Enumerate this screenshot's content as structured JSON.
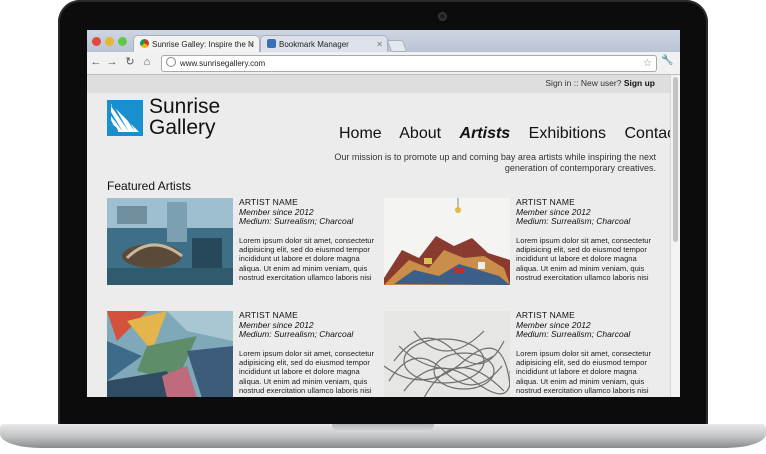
{
  "browser": {
    "tabs": [
      {
        "label": "Sunrise Galley: Inspire the N",
        "active": true
      },
      {
        "label": "Bookmark Manager",
        "active": false
      }
    ],
    "url": "www.sunrisegallery.com"
  },
  "site": {
    "signin": {
      "sign_in": "Sign in",
      "separator": " :: New user? ",
      "sign_up": "Sign up"
    },
    "logo": {
      "line1": "Sunrise",
      "line2": "Gallery"
    },
    "nav": [
      "Home",
      "About",
      "Artists",
      "Exhibitions",
      "Contact"
    ],
    "nav_active": "Artists",
    "mission": "Our mission is to promote up and coming bay area artists while inspiring the next generation of contemporary creatives.",
    "section_title": "Featured Artists",
    "artists": [
      {
        "name": "ARTIST NAME",
        "member": "Member since 2012",
        "medium": "Medium: Surrealism; Charcoal",
        "bio": "Lorem ipsum dolor sit amet, consectetur adipisicing elit, sed do eiusmod tempor incididunt ut labore et dolore magna aliqua. Ut enim ad minim veniam, quis nostrud exercitation ullamco laboris nisi"
      },
      {
        "name": "ARTIST NAME",
        "member": "Member since 2012",
        "medium": "Medium: Surrealism; Charcoal",
        "bio": "Lorem ipsum dolor sit amet, consectetur adipisicing elit, sed do eiusmod tempor incididunt ut labore et dolore magna aliqua. Ut enim ad minim veniam, quis nostrud exercitation ullamco laboris nisi"
      },
      {
        "name": "ARTIST NAME",
        "member": "Member since 2012",
        "medium": "Medium: Surrealism; Charcoal",
        "bio": "Lorem ipsum dolor sit amet, consectetur adipisicing elit, sed do eiusmod tempor incididunt ut labore et dolore magna aliqua. Ut enim ad minim veniam, quis nostrud exercitation ullamco laboris nisi"
      },
      {
        "name": "ARTIST NAME",
        "member": "Member since 2012",
        "medium": "Medium: Surrealism; Charcoal",
        "bio": "Lorem ipsum dolor sit amet, consectetur adipisicing elit, sed do eiusmod tempor incididunt ut labore et dolore magna aliqua. Ut enim ad minim veniam, quis nostrud exercitation ullamco laboris nisi"
      }
    ]
  },
  "colors": {
    "brand": "#1a8fd0",
    "page_bg": "#ececec"
  }
}
